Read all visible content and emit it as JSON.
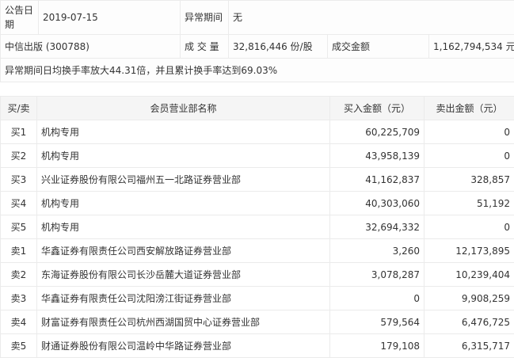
{
  "summary": {
    "date_label": "公告日期",
    "date": "2019-07-15",
    "period_label": "异常期间",
    "period": "无",
    "stock": "中信出版 (300788)",
    "volume_label": "成 交 量",
    "volume": "32,816,446 份/股",
    "amount_label": "成交金额",
    "amount": "1,162,794,534 元",
    "note": "异常期间日均换手率放大44.31倍，并且累计换手率达到69.03%"
  },
  "table": {
    "headers": [
      "买/卖",
      "会员营业部名称",
      "买入金额（元）",
      "卖出金额（元）"
    ],
    "rows": [
      {
        "side": "买1",
        "name": "机构专用",
        "buy": "60,225,709",
        "sell": "0"
      },
      {
        "side": "买2",
        "name": "机构专用",
        "buy": "43,958,139",
        "sell": "0"
      },
      {
        "side": "买3",
        "name": "兴业证券股份有限公司福州五一北路证券营业部",
        "buy": "41,162,837",
        "sell": "328,857"
      },
      {
        "side": "买4",
        "name": "机构专用",
        "buy": "40,303,060",
        "sell": "51,192"
      },
      {
        "side": "买5",
        "name": "机构专用",
        "buy": "32,694,332",
        "sell": "0"
      },
      {
        "side": "卖1",
        "name": "华鑫证券有限责任公司西安解放路证券营业部",
        "buy": "3,260",
        "sell": "12,173,895"
      },
      {
        "side": "卖2",
        "name": "东海证券股份有限公司长沙岳麓大道证券营业部",
        "buy": "3,078,287",
        "sell": "10,239,404"
      },
      {
        "side": "卖3",
        "name": "华鑫证券有限责任公司沈阳滂江街证券营业部",
        "buy": "0",
        "sell": "9,908,259"
      },
      {
        "side": "卖4",
        "name": "财富证券有限责任公司杭州西湖国贸中心证券营业部",
        "buy": "579,564",
        "sell": "6,476,725"
      },
      {
        "side": "卖5",
        "name": "财通证券股份有限公司温岭中华路证券营业部",
        "buy": "179,108",
        "sell": "6,315,717"
      }
    ]
  }
}
